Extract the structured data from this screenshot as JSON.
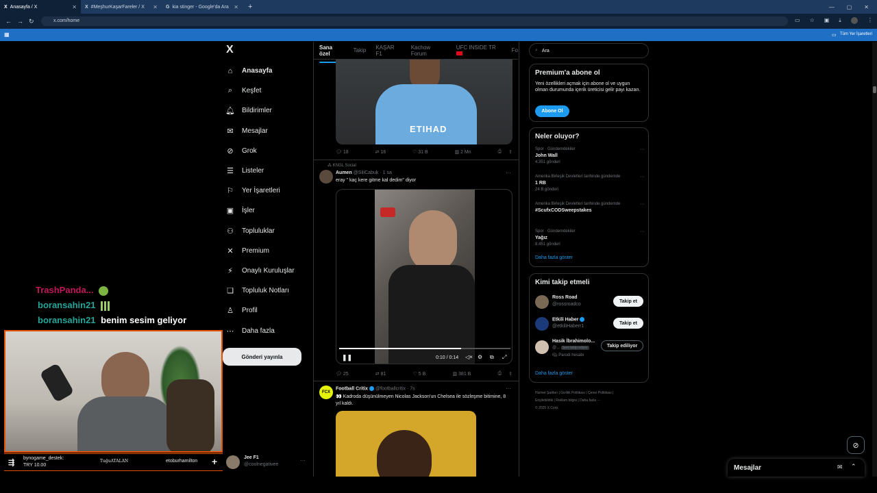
{
  "browser": {
    "tabs": [
      {
        "label": "Anasayfa / X",
        "icon": "X"
      },
      {
        "label": "#MeşhurKaşarFareler / X",
        "icon": "X"
      },
      {
        "label": "kia stinger - Google'da Ara",
        "icon": "G"
      }
    ],
    "url": "x.com/home",
    "bookmarks_label": "Tüm Yer İşaretleri"
  },
  "nav": {
    "logo": "X",
    "items": [
      {
        "label": "Anasayfa",
        "icon": "home-icon"
      },
      {
        "label": "Keşfet",
        "icon": "search-icon"
      },
      {
        "label": "Bildirimler",
        "icon": "bell-icon"
      },
      {
        "label": "Mesajlar",
        "icon": "mail-icon"
      },
      {
        "label": "Grok",
        "icon": "grok-icon"
      },
      {
        "label": "Listeler",
        "icon": "list-icon"
      },
      {
        "label": "Yer İşaretleri",
        "icon": "bookmark-icon"
      },
      {
        "label": "İşler",
        "icon": "briefcase-icon"
      },
      {
        "label": "Topluluklar",
        "icon": "people-icon"
      },
      {
        "label": "Premium",
        "icon": "x-icon"
      },
      {
        "label": "Onaylı Kuruluşlar",
        "icon": "lightning-icon"
      },
      {
        "label": "Topluluk Notları",
        "icon": "notes-icon"
      },
      {
        "label": "Profil",
        "icon": "person-icon"
      },
      {
        "label": "Daha fazla",
        "icon": "more-icon"
      }
    ],
    "post_button": "Gönderi yayınla",
    "account": {
      "name": "Jee F1",
      "handle": "@coolnegativee"
    }
  },
  "feed": {
    "tabs": [
      "Sana özel",
      "Takip",
      "KAŞAR F1",
      "Kachow Forum",
      "UFC INSIDE TR",
      "Fo"
    ],
    "post1_actions": {
      "replies": "18",
      "reposts": "18",
      "likes": "31 B",
      "views": "2 Mn"
    },
    "post2": {
      "context": "KNGL Social",
      "author": "Aumen",
      "handle": "@SiliCabuk",
      "time": "1 sa",
      "text": "eray \" kaç kere gitme kal dedim\" diyor",
      "video_time": "0:10 / 0:14",
      "actions": {
        "replies": "25",
        "reposts": "81",
        "likes": "5 B",
        "views": "381 B"
      }
    },
    "post3": {
      "author": "Football Critix",
      "handle": "@footballcritix",
      "time": "7s",
      "avatar_text": "FCX",
      "text": "👀 Kadroda düşünülmeyen Nicolas Jackson'un Chelsea ile sözleşme bitimine, 8 yıl kaldı."
    }
  },
  "right": {
    "search_placeholder": "Ara",
    "premium": {
      "title": "Premium'a abone ol",
      "body": "Yeni özellikleri açmak için abone ol ve uygun olman durumunda içerik üreticisi gelir payı kazan.",
      "button": "Abone Ol"
    },
    "trends": {
      "title": "Neler oluyor?",
      "items": [
        {
          "context": "Spor · Gündemdekiler",
          "name": "John Wall",
          "count": "4.351 gönderi"
        },
        {
          "context": "Amerika Birleşik Devletleri tarihinde gündemde",
          "name": "1 RB",
          "count": "24 B gönderi"
        },
        {
          "context": "Amerika Birleşik Devletleri tarihinde gündemde",
          "name": "#ScufxCODSweepstakes",
          "count": ""
        },
        {
          "context": "Spor · Gündemdekiler",
          "name": "Yağız",
          "count": "8.451 gönderi"
        }
      ],
      "more": "Daha fazla göster"
    },
    "follow": {
      "title": "Kimi takip etmeli",
      "items": [
        {
          "name": "Ross Road",
          "handle": "@rossroadco",
          "button": "Takip et"
        },
        {
          "name": "Etkili Haber",
          "handle": "@etkiliHaberr1",
          "button": "Takip et"
        },
        {
          "name": "Hasik İbrahimolo...",
          "handle": "@...",
          "badge": "Seni takip ediyor",
          "extra": "Parodi hesabı",
          "button": "Takip ediliyor"
        }
      ],
      "more": "Daha fazla göster"
    },
    "footer": [
      "Hizmet Şartları",
      "Gizlilik Politikası",
      "Çerez Politikası",
      "Erişilebilirlik",
      "Reklam bilgisi",
      "Daha fazla ···",
      "© 2025 X Corp."
    ],
    "messages_bar": "Mesajlar"
  },
  "stream": {
    "chat": [
      {
        "user": "TrashPanda...",
        "color": "#c2185b",
        "msg": ""
      },
      {
        "user": "boransahin21",
        "color": "#26a69a",
        "msg": ""
      },
      {
        "user": "boransahin21",
        "color": "#26a69a",
        "msg": "benim sesim geliyor"
      }
    ],
    "overflow_text": "mu",
    "donation_user": "bynogame_destek:",
    "donation_amount": "TRY 10.00",
    "ticker_1": "TuğuATALAN",
    "ticker_2": "etoburhamilton"
  }
}
